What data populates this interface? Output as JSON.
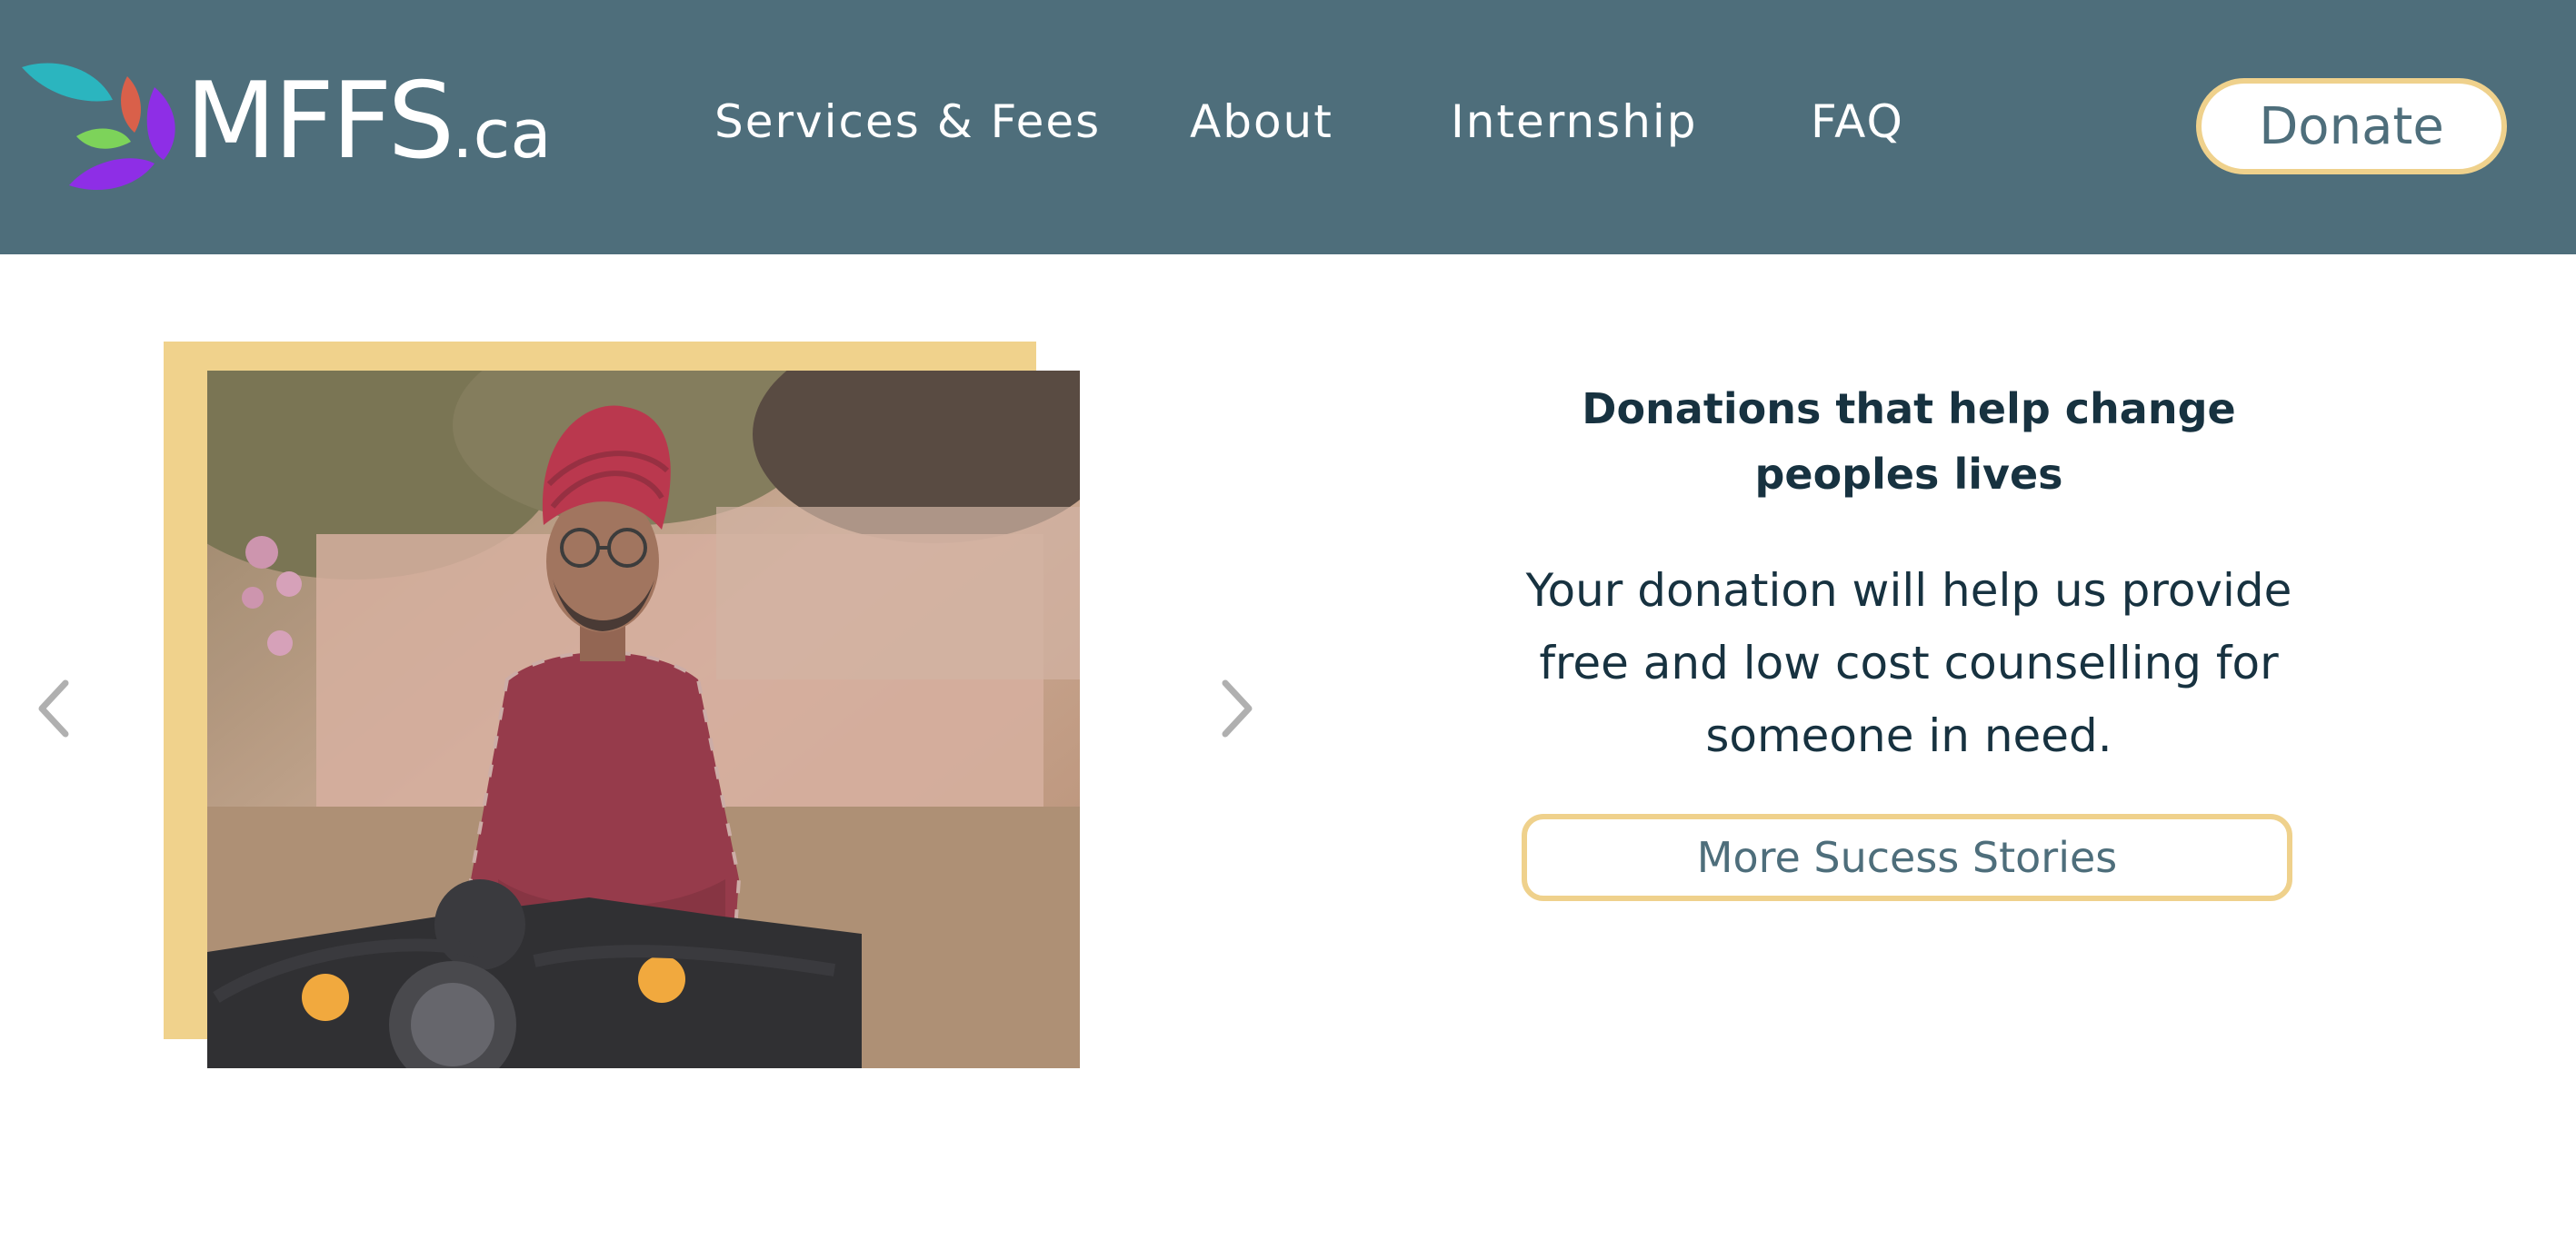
{
  "colors": {
    "header_bg": "#4e6e7b",
    "accent_gold": "#efd18c",
    "text_dark": "#173240",
    "arrow_gray": "#b0b0b0"
  },
  "logo": {
    "text": "MFFS",
    "suffix": ".ca",
    "icon": "flower-petals-icon"
  },
  "nav": {
    "items": [
      {
        "label": "Services & Fees"
      },
      {
        "label": "About"
      },
      {
        "label": "Internship"
      },
      {
        "label": "FAQ"
      }
    ]
  },
  "header": {
    "donate_label": "Donate"
  },
  "carousel": {
    "prev_icon": "chevron-left-icon",
    "next_icon": "chevron-right-icon",
    "image_subject": "person-on-motorcycle-photo"
  },
  "story": {
    "headline": "Donations that help change peoples lives",
    "body": "Your donation will help us provide free and low cost counselling for someone in need.",
    "button_label": "More Sucess Stories"
  }
}
